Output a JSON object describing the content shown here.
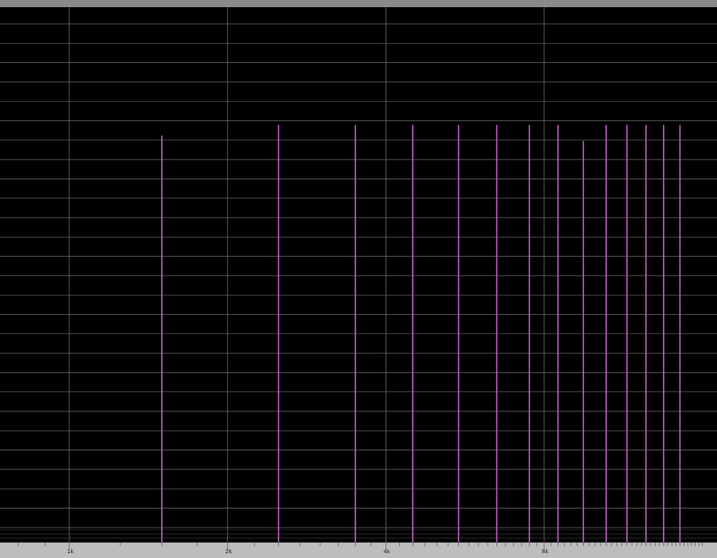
{
  "chart_data": {
    "type": "bar",
    "title": "",
    "xlabel": "",
    "ylabel": "",
    "x_scale": "log",
    "xlim": [
      500,
      15000
    ],
    "ylim": [
      0,
      1
    ],
    "grid": true,
    "x_ticks": [
      {
        "value": 1000,
        "label": "1k"
      },
      {
        "value": 2000,
        "label": "2k"
      },
      {
        "value": 4000,
        "label": "4k"
      },
      {
        "value": 8000,
        "label": "8k"
      }
    ],
    "series": [
      {
        "x": [
          1500,
          2500,
          3500,
          4500,
          5500,
          6500,
          7500,
          8500,
          9500,
          10500,
          11500,
          12500,
          13500,
          14500
        ],
        "values": [
          0.76,
          0.78,
          0.78,
          0.78,
          0.78,
          0.78,
          0.78,
          0.78,
          0.75,
          0.78,
          0.78,
          0.78,
          0.78,
          0.78
        ]
      }
    ],
    "colors": {
      "background": "#000000",
      "grid_major": "#6e6e6e",
      "grid_minor": "#3a3a3a",
      "bars": "#c45ec8",
      "frame_top": "#8a8a8a",
      "ruler": "#bdbdbd",
      "ruler_tick": "#555555",
      "tick_label": "#222222"
    }
  }
}
